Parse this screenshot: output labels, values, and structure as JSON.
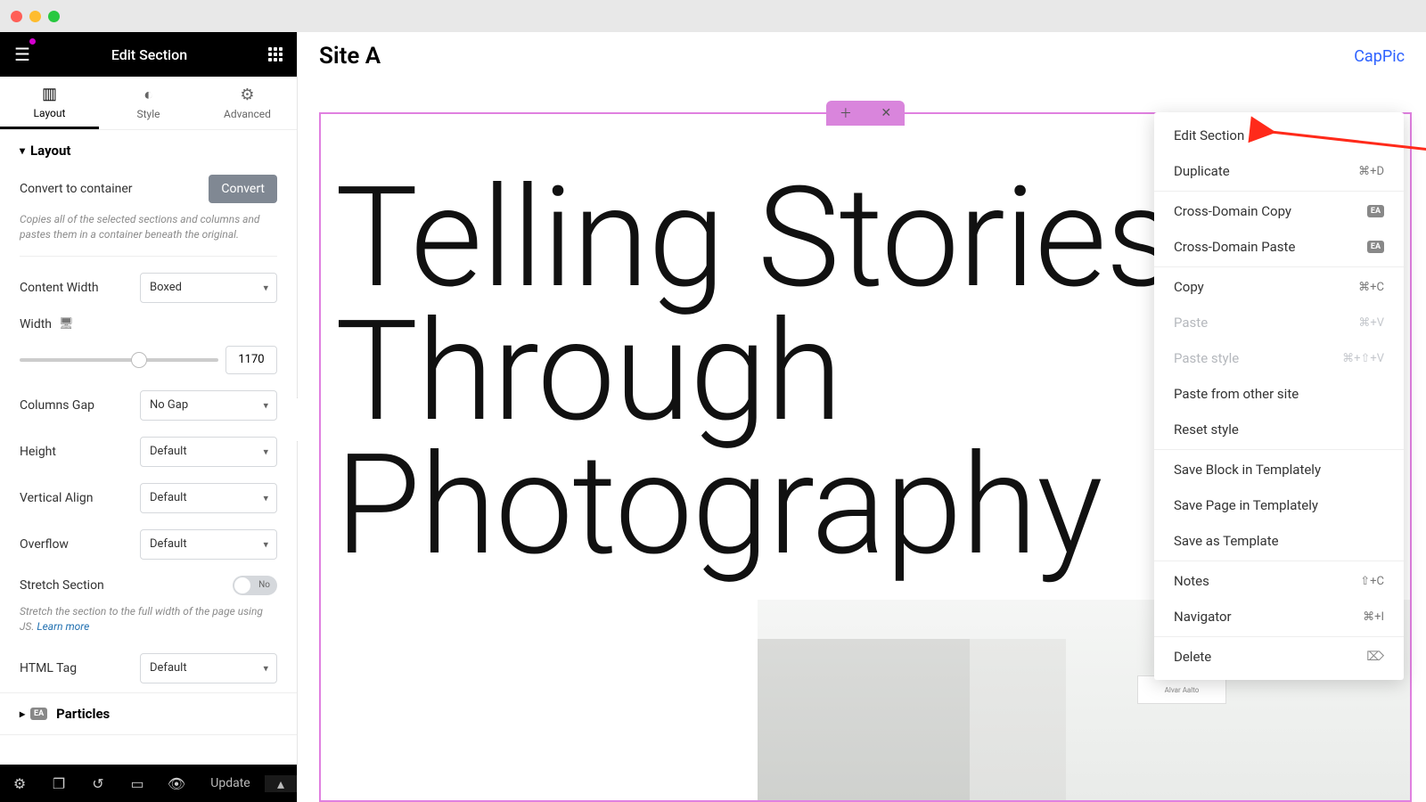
{
  "titlebar": {
    "colors": [
      "#ff5f57",
      "#febc2e",
      "#28c840"
    ]
  },
  "sidebar": {
    "header_title": "Edit Section",
    "tabs": [
      {
        "label": "Layout",
        "icon": "▥"
      },
      {
        "label": "Style",
        "icon": "◐"
      },
      {
        "label": "Advanced",
        "icon": "⚙"
      }
    ],
    "section_layout": {
      "title": "Layout",
      "convert_label": "Convert to container",
      "convert_button": "Convert",
      "convert_help": "Copies all of the selected sections and columns and pastes them in a container beneath the original.",
      "content_width_label": "Content Width",
      "content_width_value": "Boxed",
      "width_label": "Width",
      "width_value": "1170",
      "columns_gap_label": "Columns Gap",
      "columns_gap_value": "No Gap",
      "height_label": "Height",
      "height_value": "Default",
      "valign_label": "Vertical Align",
      "valign_value": "Default",
      "overflow_label": "Overflow",
      "overflow_value": "Default",
      "stretch_label": "Stretch Section",
      "stretch_value": "No",
      "stretch_help_prefix": "Stretch the section to the full width of the page using JS. ",
      "stretch_help_link": "Learn more",
      "html_tag_label": "HTML Tag",
      "html_tag_value": "Default"
    },
    "section_particles": {
      "title": "Particles",
      "badge": "EA"
    },
    "footer": {
      "update": "Update"
    }
  },
  "canvas": {
    "title": "Site A",
    "badge": "CapPic",
    "hero_line1": "Telling Stories",
    "hero_line2": "Through",
    "hero_line3": "Photography",
    "book_label": "Alvar Aalto"
  },
  "context_menu": {
    "items": [
      {
        "label": "Edit Section",
        "shortcut": "",
        "type": "item"
      },
      {
        "label": "Duplicate",
        "shortcut": "⌘+D",
        "type": "item"
      },
      {
        "type": "sep"
      },
      {
        "label": "Cross-Domain Copy",
        "badge": "EA",
        "type": "item"
      },
      {
        "label": "Cross-Domain Paste",
        "badge": "EA",
        "type": "item"
      },
      {
        "type": "sep"
      },
      {
        "label": "Copy",
        "shortcut": "⌘+C",
        "type": "item"
      },
      {
        "label": "Paste",
        "shortcut": "⌘+V",
        "type": "item",
        "disabled": true
      },
      {
        "label": "Paste style",
        "shortcut": "⌘+⇧+V",
        "type": "item",
        "disabled": true
      },
      {
        "label": "Paste from other site",
        "type": "item"
      },
      {
        "label": "Reset style",
        "type": "item"
      },
      {
        "type": "sep"
      },
      {
        "label": "Save Block in Templately",
        "type": "item"
      },
      {
        "label": "Save Page in Templately",
        "type": "item"
      },
      {
        "label": "Save as Template",
        "type": "item"
      },
      {
        "type": "sep"
      },
      {
        "label": "Notes",
        "shortcut": "⇧+C",
        "type": "item"
      },
      {
        "label": "Navigator",
        "shortcut": "⌘+I",
        "type": "item"
      },
      {
        "type": "sep"
      },
      {
        "label": "Delete",
        "icon": "⌦",
        "type": "item"
      }
    ]
  }
}
